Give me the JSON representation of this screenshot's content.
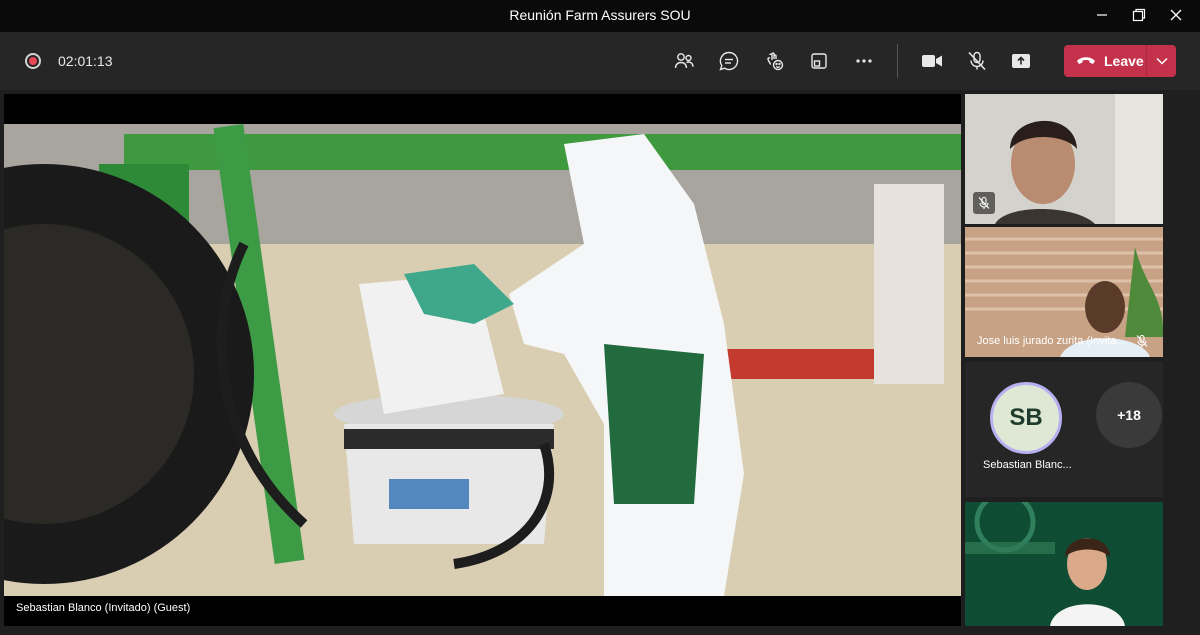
{
  "window": {
    "title": "Reunión Farm Assurers SOU",
    "controls": [
      "minimize-icon",
      "restore-icon",
      "close-icon"
    ]
  },
  "toolbar": {
    "timer": "02:01:13",
    "buttons": [
      "people-icon",
      "chat-icon",
      "reactions-icon",
      "share-tray-icon",
      "more-icon",
      "camera-icon",
      "mic-off-icon",
      "share-icon"
    ],
    "leave_label": "Leave",
    "leave_color": "#c4314b"
  },
  "main_stage": {
    "speaker_name": "Sebastian Blanco (Invitado) (Guest)"
  },
  "participants": {
    "tile1": {
      "muted": true
    },
    "tile2": {
      "name": "Jose luis jurado zurita (Invita...",
      "muted": true
    },
    "tile3": {
      "initials": "SB",
      "name": "Sebastian Blanc...",
      "more_count": "+18"
    },
    "tile4": {
      "muted": false
    }
  },
  "colors": {
    "background": "#1f1f1f",
    "titlebar": "#0a0a0a",
    "accent_green": "#2e8b3a"
  }
}
